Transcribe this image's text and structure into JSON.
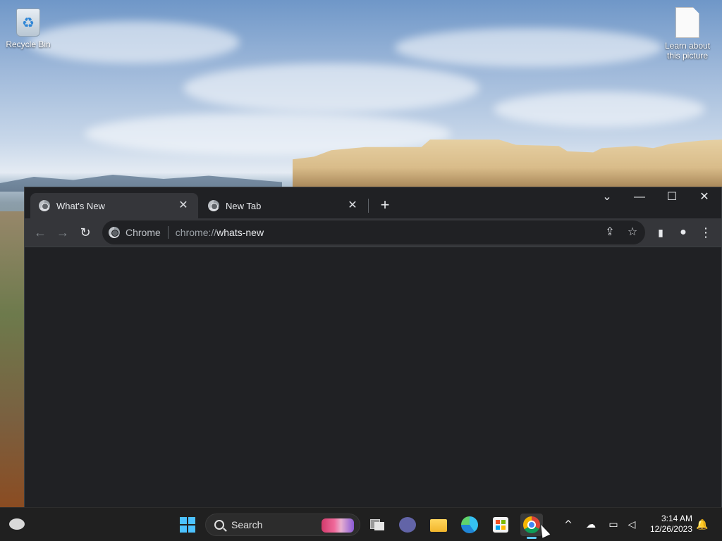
{
  "desktop": {
    "icons": [
      {
        "label": "Recycle Bin",
        "icon": "recycle-bin-icon"
      },
      {
        "label": "Learn about this picture",
        "icon": "document-icon"
      }
    ]
  },
  "browser": {
    "tabs": [
      {
        "title": "What's New",
        "active": true
      },
      {
        "title": "New Tab",
        "active": false
      }
    ],
    "tab_close": "✕",
    "new_tab": "+",
    "window_controls": {
      "tab_search": "⌄",
      "minimize": "—",
      "maximize": "☐",
      "close": "✕"
    },
    "toolbar": {
      "back": "←",
      "forward": "→",
      "reload": "↻",
      "site_chip": "Chrome",
      "url_scheme": "chrome://",
      "url_host": "whats-new",
      "share": "⇪",
      "bookmark": "☆",
      "side_panel": "▮",
      "profile": "●",
      "menu": "⋮"
    }
  },
  "taskbar": {
    "search_label": "Search",
    "clock_time": "3:14 AM",
    "clock_date": "12/26/2023",
    "tray_overflow": "^",
    "pinned": [
      "start",
      "search",
      "task-view",
      "meet",
      "file-explorer",
      "edge",
      "store",
      "chrome"
    ],
    "accent": "#60cdff"
  }
}
